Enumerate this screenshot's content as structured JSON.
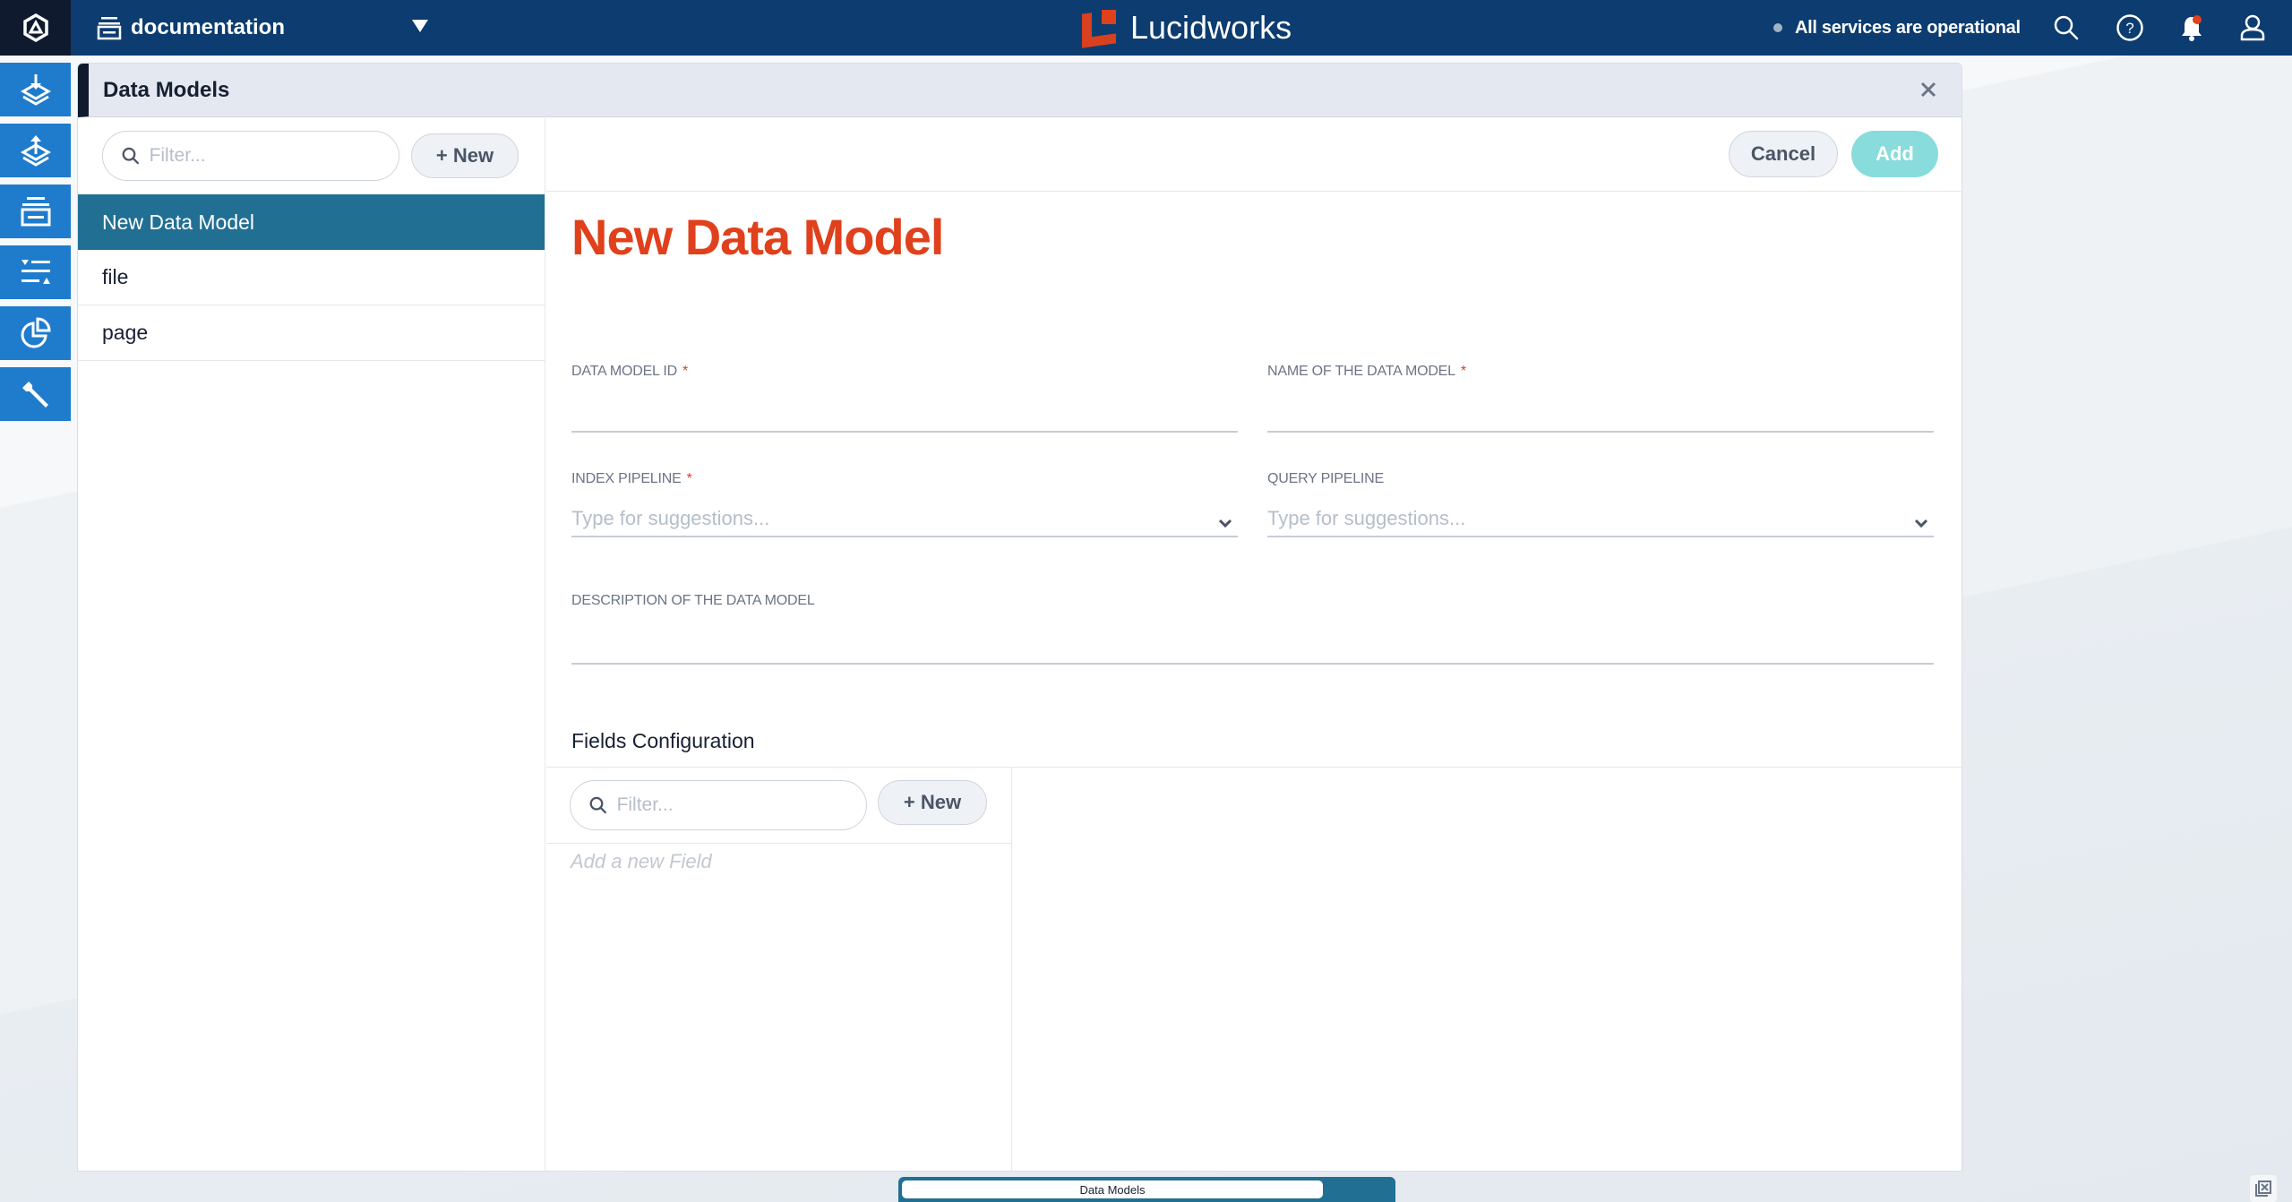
{
  "topbar": {
    "logo_icon": "fusion-hexagon-logo-icon",
    "app_icon": "app-stack-icon",
    "app_name": "documentation",
    "brand_name": "Lucidworks",
    "status_text": "All services are operational",
    "icons": [
      "search-icon",
      "help-icon",
      "notification-bell-icon",
      "user-icon"
    ],
    "notification_badge_color": "#e0401b"
  },
  "rail": {
    "items": [
      {
        "icon": "index-collect-icon",
        "name": "collect"
      },
      {
        "icon": "query-icon",
        "name": "query"
      },
      {
        "icon": "collections-icon",
        "name": "collections"
      },
      {
        "icon": "relevance-icon",
        "name": "relevance"
      },
      {
        "icon": "analytics-icon",
        "name": "analytics"
      },
      {
        "icon": "system-wrench-icon",
        "name": "system"
      }
    ],
    "color": "#1f7ccd"
  },
  "modal": {
    "title": "Data Models",
    "list": {
      "filter_placeholder": "Filter...",
      "new_label": "+ New",
      "items": [
        {
          "label": "New Data Model",
          "active": true
        },
        {
          "label": "file",
          "active": false
        },
        {
          "label": "page",
          "active": false
        }
      ]
    },
    "actions": {
      "cancel_label": "Cancel",
      "add_label": "Add"
    },
    "form": {
      "title": "New Data Model",
      "fields": {
        "data_model_id": {
          "label": "DATA MODEL ID",
          "required": "*",
          "value": ""
        },
        "name": {
          "label": "NAME OF THE DATA MODEL",
          "required": "*",
          "value": ""
        },
        "index_pipeline": {
          "label": "INDEX PIPELINE",
          "required": "*",
          "placeholder": "Type for suggestions...",
          "value": ""
        },
        "query_pipeline": {
          "label": "QUERY PIPELINE",
          "placeholder": "Type for suggestions...",
          "value": ""
        },
        "description": {
          "label": "DESCRIPTION OF THE DATA MODEL",
          "value": ""
        }
      }
    },
    "fields_config": {
      "title": "Fields Configuration",
      "filter_placeholder": "Filter...",
      "new_label": "+ New",
      "empty_text": "Add a new Field"
    }
  },
  "tray": {
    "tab_label": "Data Models"
  },
  "colors": {
    "topbar": "#0c3c70",
    "accent_orange": "#e0401b",
    "active_item": "#226f94",
    "add_button": "#88dcdc"
  }
}
